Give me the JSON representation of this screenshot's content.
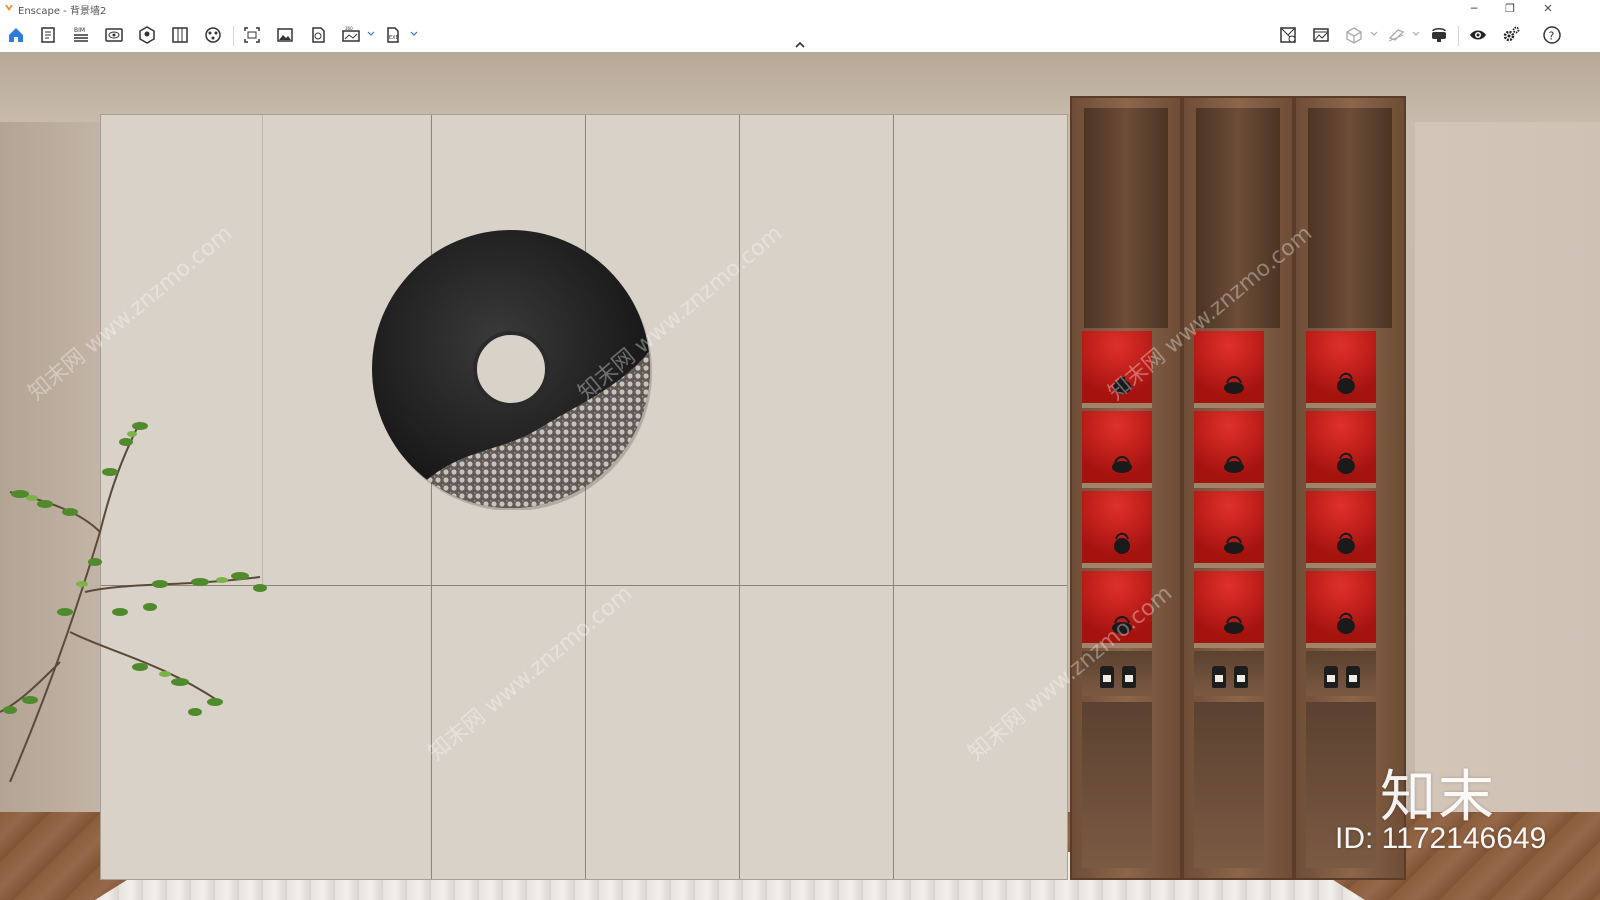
{
  "window": {
    "app_name": "Enscape",
    "title": "Enscape - 背景墙2",
    "controls": {
      "minimize": "─",
      "restore": "❐",
      "close": "✕"
    }
  },
  "toolbar": {
    "left_buttons": [
      {
        "icon": "home-icon"
      },
      {
        "icon": "notes-icon"
      },
      {
        "icon": "bim-icon",
        "label": "BIM"
      },
      {
        "icon": "views-icon"
      },
      {
        "icon": "asset-library-icon"
      },
      {
        "icon": "material-editor-icon"
      },
      {
        "icon": "atmosphere-icon"
      },
      {
        "icon": "screenshot-icon"
      },
      {
        "icon": "image-export-icon"
      },
      {
        "icon": "panorama-icon"
      },
      {
        "icon": "video-icon"
      },
      {
        "icon": "export-file-icon"
      }
    ],
    "right_buttons": [
      {
        "icon": "sync-views-icon"
      },
      {
        "icon": "capture-icon"
      },
      {
        "icon": "cube-icon"
      },
      {
        "icon": "section-icon"
      },
      {
        "icon": "vr-headset-icon"
      },
      {
        "icon": "visibility-icon"
      },
      {
        "icon": "settings-icon"
      },
      {
        "icon": "help-icon",
        "label": "?"
      }
    ]
  },
  "viewport": {
    "watermark_brand": "知末",
    "watermark_id": "ID: 1172146649",
    "watermark_diagonal": "知末网 www.znzmo.com"
  }
}
